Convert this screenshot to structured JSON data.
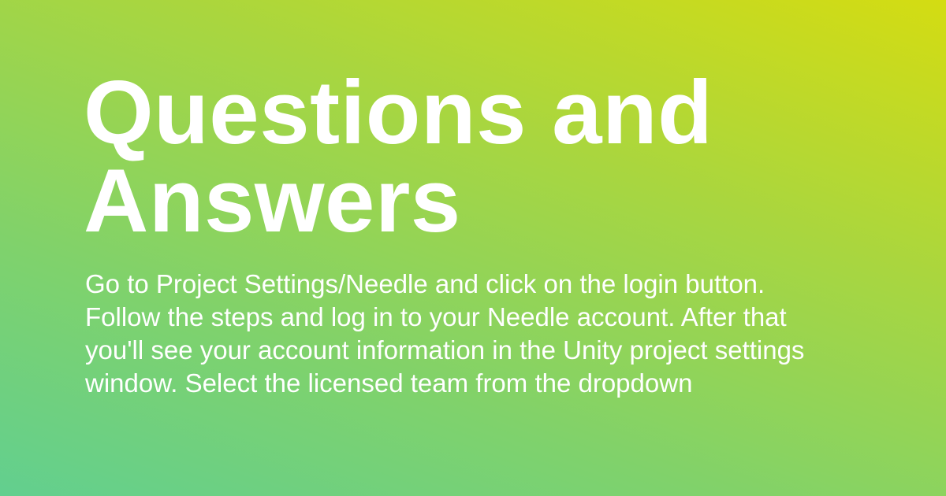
{
  "title": "Questions and Answers",
  "description": "Go to Project Settings/Needle and click on the login button. Follow the steps and log in to your Needle account. After that you'll see your account information in the Unity project settings window. Select the licensed team from the dropdown",
  "colors": {
    "gradient_top_right": "#d4dc12",
    "gradient_bottom_left": "#62cf8f",
    "text": "#ffffff"
  }
}
